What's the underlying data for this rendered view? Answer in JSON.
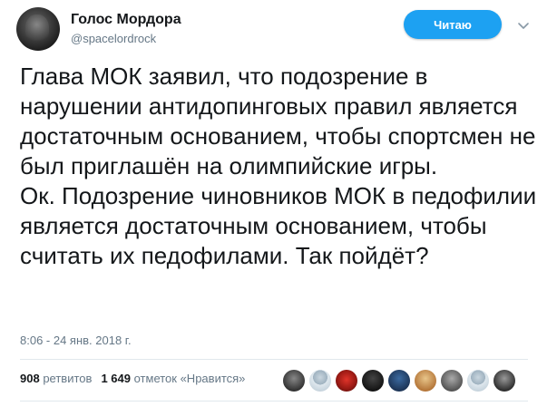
{
  "tweet": {
    "author_name": "Голос Мордора",
    "author_handle": "@spacelordrock",
    "follow_label": "Читаю",
    "text_lines": [
      "Глава МОК заявил, что подозрение в нарушении антидопинговых правил является достаточным основанием, чтобы спортсмен не был приглашён на олимпийские игры.",
      "Ок. Подозрение чиновников МОК в педофилии является достаточным основанием, чтобы считать их педофилами. Так пойдёт?"
    ],
    "timestamp": "8:06 - 24 янв. 2018 г.",
    "retweets_count": "908",
    "retweets_label": "ретвитов",
    "likes_count": "1 649",
    "likes_label": "отметок «Нравится»"
  },
  "colors": {
    "accent": "#1da1f2",
    "secondary_text": "#657786"
  },
  "icons": {
    "caret": "chevron-down-icon"
  }
}
